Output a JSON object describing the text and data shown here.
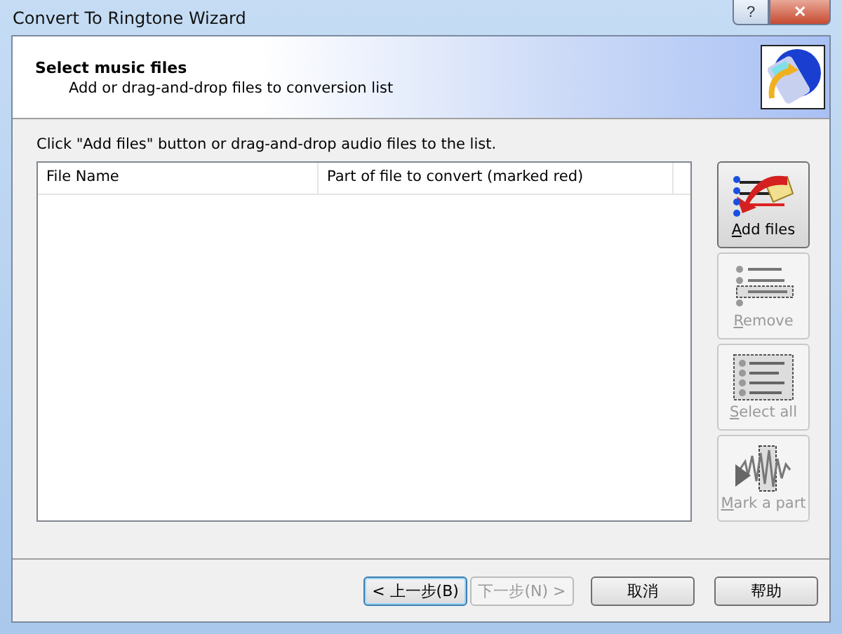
{
  "window": {
    "title": "Convert To Ringtone Wizard",
    "controls": [
      "?",
      "✕"
    ]
  },
  "header": {
    "title": "Select music files",
    "subtitle": "Add or drag-and-drop files to conversion list"
  },
  "instruction": "Click \"Add files\" button or drag-and-drop audio files to the list.",
  "table": {
    "columns": [
      "File Name",
      "Part of file to convert (marked red)"
    ]
  },
  "side_buttons": [
    {
      "kind": "add",
      "label": "Add files",
      "disabled": false
    },
    {
      "kind": "remove",
      "label": "Remove",
      "disabled": true
    },
    {
      "kind": "select",
      "label": "Select all",
      "disabled": true
    },
    {
      "kind": "mark",
      "label": "Mark a part",
      "disabled": true
    }
  ],
  "footer_buttons": [
    {
      "label": "< 上一步(B)",
      "disabled": false,
      "focused": true
    },
    {
      "label": "下一步(N) >",
      "disabled": true,
      "focused": false
    },
    {
      "label": "取消",
      "disabled": false,
      "focused": false
    },
    {
      "label": "帮助",
      "disabled": false,
      "focused": false
    }
  ]
}
